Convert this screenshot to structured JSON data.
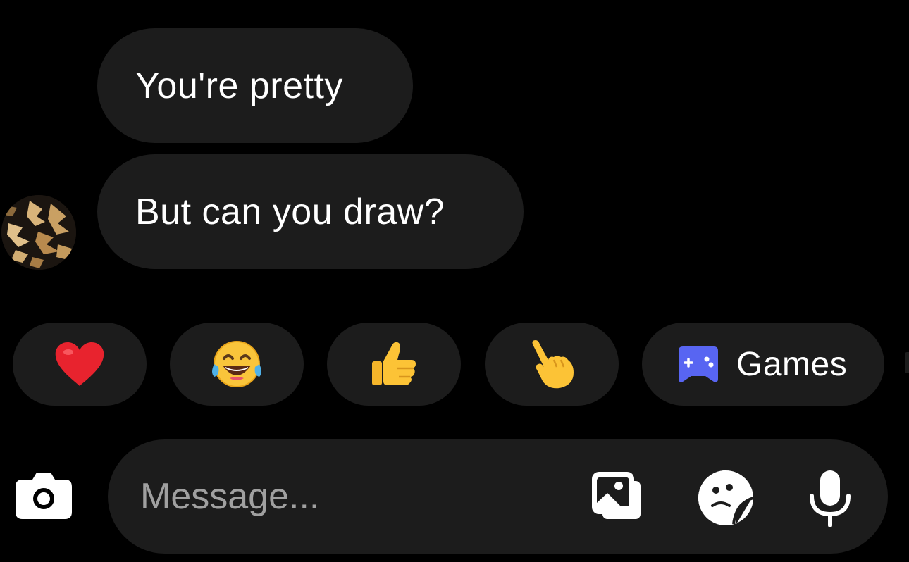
{
  "messages": [
    {
      "text": "You're pretty"
    },
    {
      "text": "But can you draw?"
    }
  ],
  "quick_reactions": {
    "items": [
      {
        "emoji": "heart-emoji"
      },
      {
        "emoji": "tears-of-joy-emoji"
      },
      {
        "emoji": "thumbs-up-emoji"
      },
      {
        "emoji": "pointing-hand-emoji"
      }
    ],
    "games_label": "Games",
    "games_icon": "game-controller-icon"
  },
  "composer": {
    "placeholder": "Message...",
    "camera_icon": "camera-icon",
    "gallery_icon": "gallery-icon",
    "sticker_icon": "sticker-icon",
    "mic_icon": "microphone-icon"
  },
  "colors": {
    "background": "#000000",
    "bubble": "#1c1c1c",
    "text": "#ffffff",
    "placeholder": "#a0a0a0",
    "games_accent": "#5865f2"
  }
}
